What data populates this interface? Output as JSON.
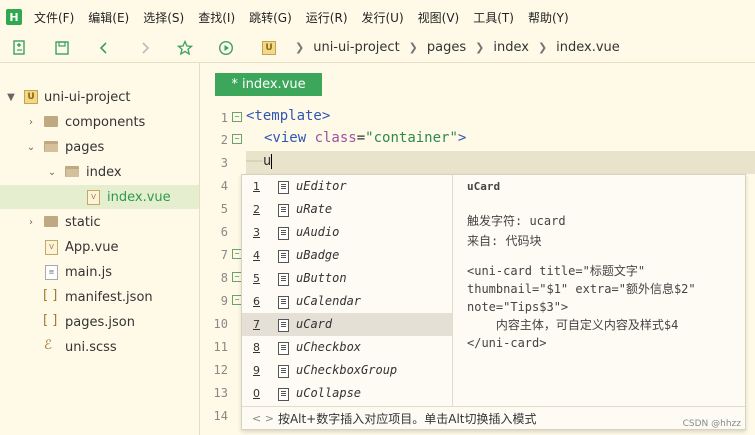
{
  "menubar": {
    "logo": "H",
    "items": [
      "文件(F)",
      "编辑(E)",
      "选择(S)",
      "查找(I)",
      "跳转(G)",
      "运行(R)",
      "发行(U)",
      "视图(V)",
      "工具(T)",
      "帮助(Y)"
    ]
  },
  "toolbar": {
    "breadcrumb": [
      "uni-ui-project",
      "pages",
      "index",
      "index.vue"
    ],
    "breadcrumb_icon": "U"
  },
  "sidebar": {
    "items": [
      {
        "label": "uni-ui-project",
        "icon": "project-icon"
      },
      {
        "label": "components",
        "icon": "folder-icon"
      },
      {
        "label": "pages",
        "icon": "folder-icon"
      },
      {
        "label": "index",
        "icon": "folder-icon"
      },
      {
        "label": "index.vue",
        "icon": "vue-file-icon"
      },
      {
        "label": "static",
        "icon": "folder-icon"
      },
      {
        "label": "App.vue",
        "icon": "vue-file-icon"
      },
      {
        "label": "main.js",
        "icon": "js-file-icon"
      },
      {
        "label": "manifest.json",
        "icon": "json-file-icon"
      },
      {
        "label": "pages.json",
        "icon": "json-file-icon"
      },
      {
        "label": "uni.scss",
        "icon": "scss-file-icon"
      }
    ]
  },
  "editor": {
    "tab_label": "* index.vue",
    "line_numbers": [
      "1",
      "2",
      "3",
      "4",
      "5",
      "6",
      "7",
      "8",
      "9",
      "10",
      "11",
      "12",
      "13",
      "14"
    ],
    "line1": {
      "tag": "<template>"
    },
    "line2": {
      "open": "<view ",
      "attr": "class",
      "eq": "=",
      "value": "\"container\"",
      "close": ">"
    },
    "line3": {
      "guide": "——",
      "typed": "u"
    }
  },
  "autocomplete": {
    "items": [
      {
        "num": "1",
        "label": "uEditor"
      },
      {
        "num": "2",
        "label": "uRate"
      },
      {
        "num": "3",
        "label": "uAudio"
      },
      {
        "num": "4",
        "label": "uBadge"
      },
      {
        "num": "5",
        "label": "uButton"
      },
      {
        "num": "6",
        "label": "uCalendar"
      },
      {
        "num": "7",
        "label": "uCard"
      },
      {
        "num": "8",
        "label": "uCheckbox"
      },
      {
        "num": "9",
        "label": "uCheckboxGroup"
      },
      {
        "num": "0",
        "label": "uCollapse"
      }
    ],
    "selected_index": 6,
    "detail": {
      "title": "uCard",
      "trigger": "触发字符: ucard",
      "from": "来自: 代码块",
      "code": "<uni-card title=\"标题文字\"\nthumbnail=\"$1\" extra=\"额外信息$2\"\nnote=\"Tips$3\">\n    内容主体，可自定义内容及样式$4\n</uni-card>"
    },
    "footer": "按Alt+数字插入对应项目。单击Alt切换插入模式",
    "footer_nav": "<  >"
  },
  "watermark": "CSDN @hhzz"
}
